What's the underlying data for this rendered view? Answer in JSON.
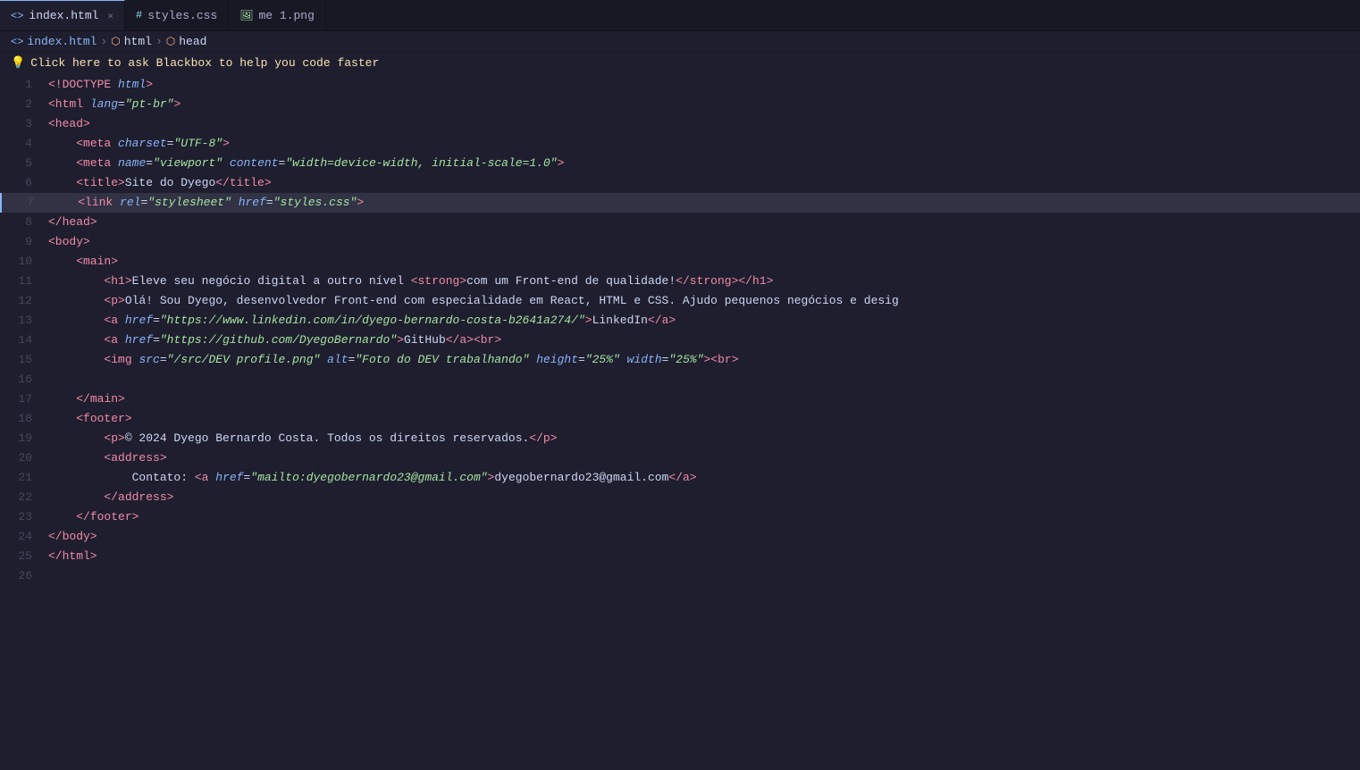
{
  "tabs": [
    {
      "id": "index-html",
      "label": "index.html",
      "icon": "html-icon",
      "active": true,
      "closable": true
    },
    {
      "id": "styles-css",
      "label": "styles.css",
      "icon": "css-icon",
      "active": false,
      "closable": false
    },
    {
      "id": "me-png",
      "label": "me 1.png",
      "icon": "png-icon",
      "active": false,
      "closable": false
    }
  ],
  "breadcrumb": {
    "items": [
      "index.html",
      "html",
      "head"
    ]
  },
  "blackbox": {
    "banner": "Click here to ask Blackbox to help you code faster"
  },
  "lines": [
    {
      "num": 1,
      "content": "<!DOCTYPE html>",
      "highlight": false
    },
    {
      "num": 2,
      "content": "<html lang=\"pt-br\">",
      "highlight": false
    },
    {
      "num": 3,
      "content": "<head>",
      "highlight": false
    },
    {
      "num": 4,
      "content": "    <meta charset=\"UTF-8\">",
      "highlight": false
    },
    {
      "num": 5,
      "content": "    <meta name=\"viewport\" content=\"width=device-width, initial-scale=1.0\">",
      "highlight": false
    },
    {
      "num": 6,
      "content": "    <title>Site do Dyego</title>",
      "highlight": false
    },
    {
      "num": 7,
      "content": "    <link rel=\"stylesheet\" href=\"styles.css\">",
      "highlight": true
    },
    {
      "num": 8,
      "content": "</head>",
      "highlight": false
    },
    {
      "num": 9,
      "content": "<body>",
      "highlight": false
    },
    {
      "num": 10,
      "content": "    <main>",
      "highlight": false
    },
    {
      "num": 11,
      "content": "        <h1>Eleve seu negócio digital a outro nível <strong>com um Front-end de qualidade!</strong></h1>",
      "highlight": false
    },
    {
      "num": 12,
      "content": "        <p>Olá! Sou Dyego, desenvolvedor Front-end com especialidade em React, HTML e CSS. Ajudo pequenos negócios e desig",
      "highlight": false
    },
    {
      "num": 13,
      "content": "        <a href=\"https://www.linkedin.com/in/dyego-bernardo-costa-b2641a274/\">LinkedIn</a>",
      "highlight": false
    },
    {
      "num": 14,
      "content": "        <a href=\"https://github.com/DyegoBernardo\">GitHub</a><br>",
      "highlight": false
    },
    {
      "num": 15,
      "content": "        <img src=\"/src/DEV profile.png\" alt=\"Foto do DEV trabalhando\" height=\"25%\" width=\"25%\"><br>",
      "highlight": false
    },
    {
      "num": 16,
      "content": "",
      "highlight": false
    },
    {
      "num": 17,
      "content": "    </main>",
      "highlight": false
    },
    {
      "num": 18,
      "content": "    <footer>",
      "highlight": false
    },
    {
      "num": 19,
      "content": "        <p>© 2024 Dyego Bernardo Costa. Todos os direitos reservados.</p>",
      "highlight": false
    },
    {
      "num": 20,
      "content": "        <address>",
      "highlight": false
    },
    {
      "num": 21,
      "content": "            Contato: <a href=\"mailto:dyegobernardo23@gmail.com\">dyegobernardo23@gmail.com</a>",
      "highlight": false
    },
    {
      "num": 22,
      "content": "        </address>",
      "highlight": false
    },
    {
      "num": 23,
      "content": "    </footer>",
      "highlight": false
    },
    {
      "num": 24,
      "content": "</body>",
      "highlight": false
    },
    {
      "num": 25,
      "content": "</html>",
      "highlight": false
    },
    {
      "num": 26,
      "content": "",
      "highlight": false
    }
  ]
}
